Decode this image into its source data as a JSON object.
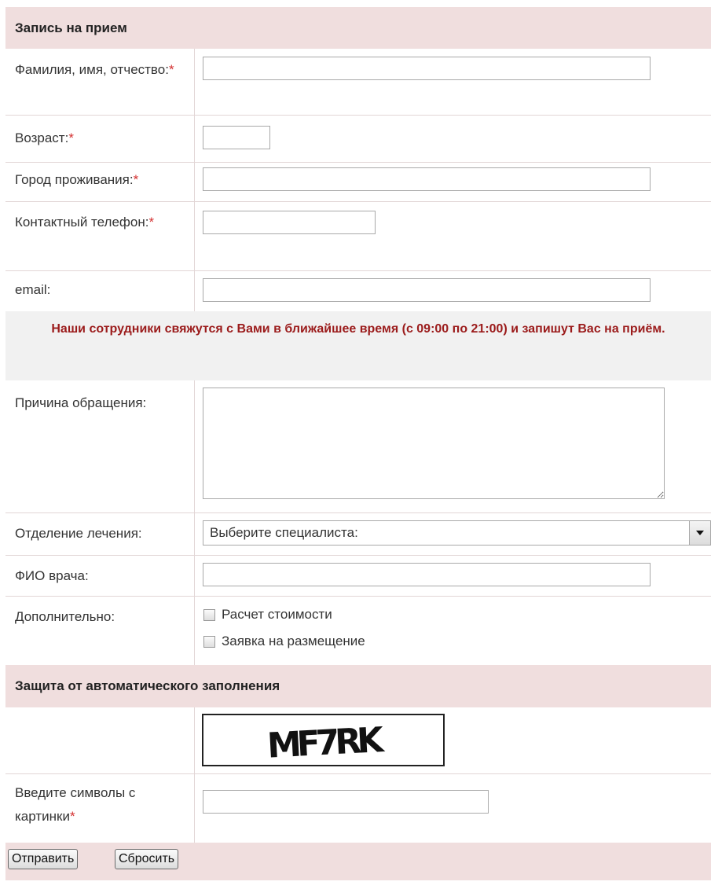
{
  "header": {
    "title": "Запись на прием"
  },
  "fields": {
    "fio": {
      "label": "Фамилия, имя, отчество:",
      "value": ""
    },
    "age": {
      "label": "Возраст:",
      "value": ""
    },
    "city": {
      "label": "Город проживания:",
      "value": ""
    },
    "phone": {
      "label": "Контактный телефон:",
      "value": ""
    },
    "email": {
      "label": "email:",
      "value": ""
    },
    "reason": {
      "label": "Причина обращения:",
      "value": ""
    },
    "department": {
      "label": "Отделение лечения:",
      "selected": "Выберите специалиста:"
    },
    "doctor": {
      "label": "ФИО врача:",
      "value": ""
    },
    "extra": {
      "label": "Дополнительно:",
      "options": [
        {
          "label": "Расчет стоимости",
          "checked": false
        },
        {
          "label": "Заявка на размещение",
          "checked": false
        }
      ]
    }
  },
  "required_mark": "*",
  "notice": "Наши сотрудники свяжутся с Вами в ближайшее время (с 09:00 по 21:00) и запишут Вас на приём.",
  "captcha_section": {
    "title": "Защита от автоматического заполнения",
    "code": "MF7RK",
    "input_label": "Введите символы с картинки",
    "value": ""
  },
  "buttons": {
    "submit": "Отправить",
    "reset": "Сбросить"
  }
}
